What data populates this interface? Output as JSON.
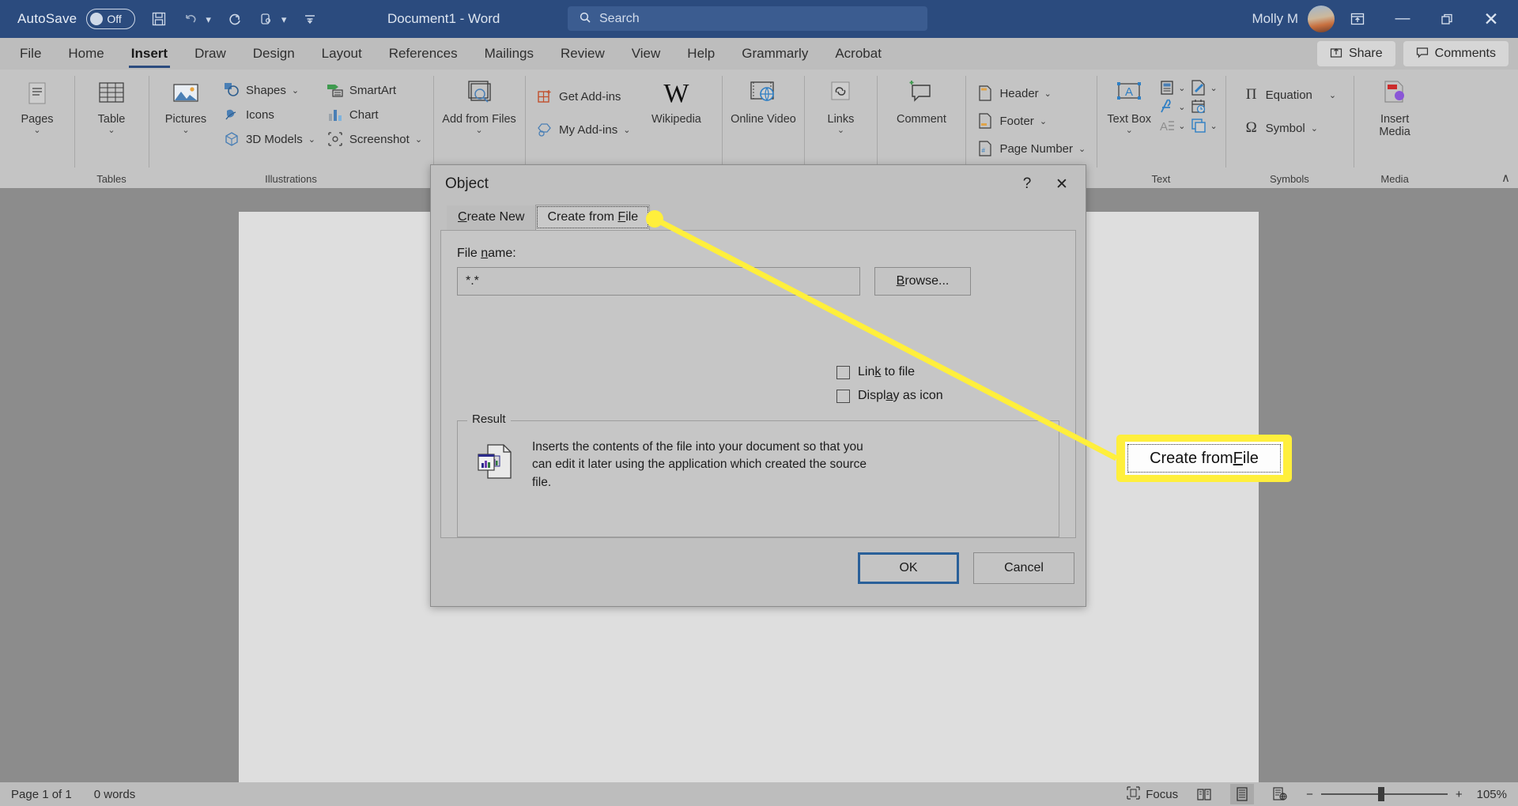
{
  "titlebar": {
    "autosave_label": "AutoSave",
    "autosave_state": "Off",
    "document_title": "Document1  -  Word",
    "search_placeholder": "Search",
    "user_name": "Molly M",
    "icons": [
      "save-icon",
      "undo-icon",
      "redo-icon",
      "touch-mode-icon",
      "customize-quick-access-icon"
    ],
    "window_buttons": [
      "ribbon-display-options",
      "minimize",
      "restore",
      "close"
    ]
  },
  "tabs": {
    "items": [
      {
        "label": "File"
      },
      {
        "label": "Home"
      },
      {
        "label": "Insert"
      },
      {
        "label": "Draw"
      },
      {
        "label": "Design"
      },
      {
        "label": "Layout"
      },
      {
        "label": "References"
      },
      {
        "label": "Mailings"
      },
      {
        "label": "Review"
      },
      {
        "label": "View"
      },
      {
        "label": "Help"
      },
      {
        "label": "Grammarly"
      },
      {
        "label": "Acrobat"
      }
    ],
    "active": "Insert",
    "share_label": "Share",
    "comments_label": "Comments"
  },
  "ribbon": {
    "groups": [
      {
        "name": "",
        "big": [
          {
            "label": "Pages",
            "caret": "⌄",
            "icon": "pages-icon"
          }
        ]
      },
      {
        "name": "Tables",
        "big": [
          {
            "label": "Table",
            "caret": "⌄",
            "icon": "table-icon"
          }
        ]
      },
      {
        "name": "Illustrations",
        "big": [
          {
            "label": "Pictures",
            "caret": "⌄",
            "icon": "pictures-icon"
          }
        ],
        "small_col1": [
          {
            "label": "Shapes",
            "caret": "⌄",
            "icon": "shapes-icon"
          },
          {
            "label": "Icons",
            "caret": "",
            "icon": "icons-icon"
          },
          {
            "label": "3D Models",
            "caret": "⌄",
            "icon": "3d-models-icon"
          }
        ],
        "small_col2": [
          {
            "label": "SmartArt",
            "caret": "",
            "icon": "smartart-icon"
          },
          {
            "label": "Chart",
            "caret": "",
            "icon": "chart-icon"
          },
          {
            "label": "Screenshot",
            "caret": "⌄",
            "icon": "screenshot-icon"
          }
        ]
      },
      {
        "name": "",
        "big": [
          {
            "label": "Add from Files",
            "caret": "⌄",
            "icon": "add-from-files-icon"
          }
        ]
      },
      {
        "name": "",
        "small_col1": [
          {
            "label": "Get Add-ins",
            "caret": "",
            "icon": "get-addins-icon"
          },
          {
            "label": "My Add-ins",
            "caret": "⌄",
            "icon": "my-addins-icon"
          }
        ],
        "big": [
          {
            "label": "Wikipedia",
            "caret": "",
            "icon": "wikipedia-icon"
          }
        ]
      },
      {
        "name": "",
        "big": [
          {
            "label": "Online Video",
            "caret": "",
            "icon": "online-video-icon"
          }
        ]
      },
      {
        "name": "",
        "big": [
          {
            "label": "Links",
            "caret": "⌄",
            "icon": "links-icon"
          }
        ]
      },
      {
        "name": "",
        "big": [
          {
            "label": "Comment",
            "caret": "",
            "icon": "comment-icon"
          }
        ]
      },
      {
        "name": "",
        "small_col1": [
          {
            "label": "Header",
            "caret": "⌄",
            "icon": "header-icon"
          },
          {
            "label": "Footer",
            "caret": "⌄",
            "icon": "footer-icon"
          },
          {
            "label": "Page Number",
            "caret": "⌄",
            "icon": "page-number-icon"
          }
        ]
      },
      {
        "name": "Text",
        "big": [
          {
            "label": "Text Box",
            "caret": "⌄",
            "icon": "text-box-icon"
          }
        ],
        "grid": [
          {
            "icon": "quick-parts-icon",
            "caret": "⌄"
          },
          {
            "icon": "signature-line-icon",
            "caret": "⌄"
          },
          {
            "icon": "wordart-icon",
            "caret": "⌄"
          },
          {
            "icon": "date-time-icon",
            "caret": ""
          },
          {
            "icon": "drop-cap-icon",
            "caret": "⌄"
          },
          {
            "icon": "object-icon",
            "caret": "⌄"
          }
        ]
      },
      {
        "name": "Symbols",
        "small_col1": [
          {
            "label": "Equation",
            "caret": "⌄",
            "icon": "equation-icon"
          },
          {
            "label": "Symbol",
            "caret": "⌄",
            "icon": "symbol-icon"
          }
        ]
      },
      {
        "name": "Media",
        "big": [
          {
            "label": "Insert Media",
            "caret": "",
            "icon": "insert-media-icon"
          }
        ]
      }
    ],
    "collapse_caret": "∧"
  },
  "dialog": {
    "title": "Object",
    "help_glyph": "?",
    "close_glyph": "✕",
    "tabs": [
      {
        "label_pre": "",
        "label": "Create New",
        "accel": "C",
        "selected": false
      },
      {
        "label": "Create from File",
        "accel": "F",
        "selected": true
      }
    ],
    "file_name_label": "File name:",
    "file_name_value": "*.*",
    "browse_label": "Browse...",
    "checkboxes": [
      {
        "label": "Link to file",
        "checked": false
      },
      {
        "label": "Display as icon",
        "checked": false
      }
    ],
    "result_legend": "Result",
    "result_text": "Inserts the contents of the file into your document so that you can edit it later using the application which created the source file.",
    "ok_label": "OK",
    "cancel_label": "Cancel"
  },
  "annotation": {
    "callout_text": "Create from File",
    "highlight_color": "#ffef3c"
  },
  "statusbar": {
    "page_info": "Page 1 of 1",
    "word_count": "0 words",
    "focus_label": "Focus",
    "zoom_level": "105%",
    "zoom_minus": "−",
    "zoom_plus": "+",
    "view_icons": [
      "read-mode-icon",
      "print-layout-icon",
      "web-layout-icon"
    ]
  }
}
